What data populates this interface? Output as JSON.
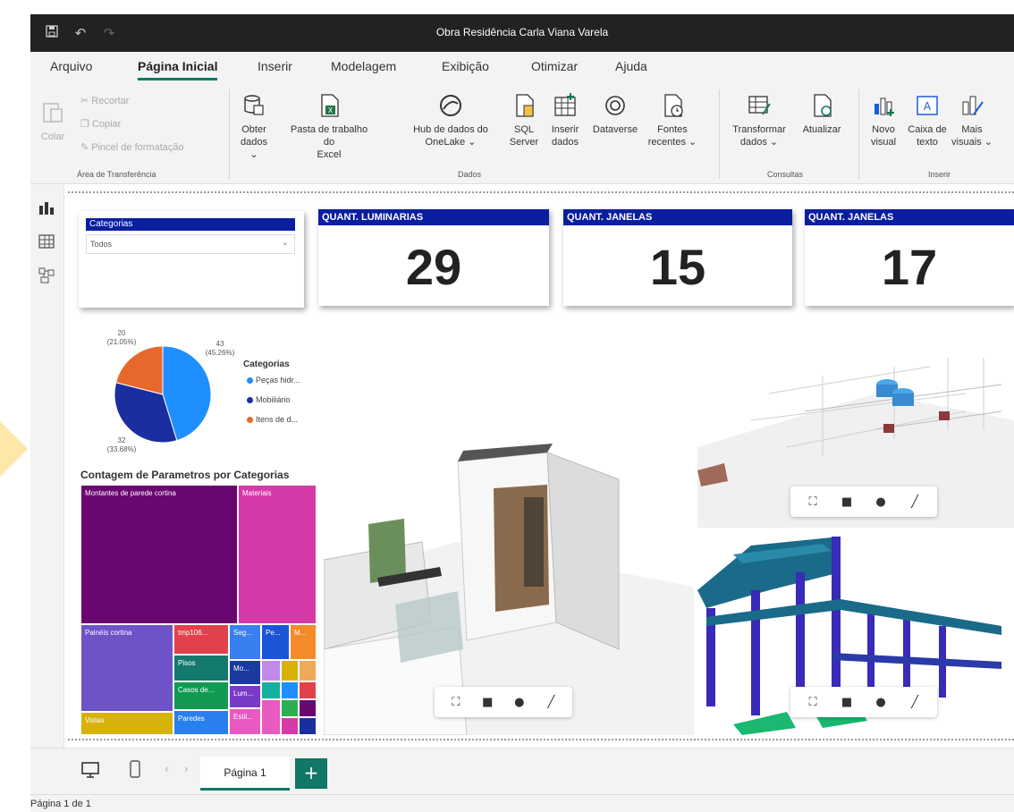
{
  "window": {
    "title": "Obra Residência Carla Viana Varela"
  },
  "menu": {
    "tabs": [
      {
        "label": "Arquivo"
      },
      {
        "label": "Página Inicial"
      },
      {
        "label": "Inserir"
      },
      {
        "label": "Modelagem"
      },
      {
        "label": "Exibição"
      },
      {
        "label": "Otimizar"
      },
      {
        "label": "Ajuda"
      }
    ]
  },
  "ribbon": {
    "clipboard": {
      "paste": "Colar",
      "cut": "Recortar",
      "copy": "Copiar",
      "format_painter": "Pincel de formatação",
      "group": "Área de Transferência"
    },
    "data": {
      "get_data_1": "Obter",
      "get_data_2": "dados ⌄",
      "excel_1": "Pasta de trabalho do",
      "excel_2": "Excel",
      "onelake_1": "Hub de dados do",
      "onelake_2": "OneLake ⌄",
      "sql_1": "SQL",
      "sql_2": "Server",
      "insert_1": "Inserir",
      "insert_2": "dados",
      "dataverse": "Dataverse",
      "recent_1": "Fontes",
      "recent_2": "recentes ⌄",
      "group": "Dados"
    },
    "queries": {
      "transform_1": "Transformar",
      "transform_2": "dados ⌄",
      "refresh": "Atualizar",
      "group": "Consultas"
    },
    "insert": {
      "new_visual_1": "Novo",
      "new_visual_2": "visual",
      "textbox_1": "Caixa de",
      "textbox_2": "texto",
      "more_1": "Mais",
      "more_2": "visuais ⌄",
      "group": "Inserir"
    }
  },
  "slicer": {
    "title": "Categorias",
    "value": "Todos"
  },
  "kpis": [
    {
      "label": "QUANT. LUMINARIAS",
      "value": "29"
    },
    {
      "label": "QUANT. JANELAS",
      "value": "15"
    },
    {
      "label": "QUANT. JANELAS",
      "value": "17"
    }
  ],
  "pie": {
    "legend_title": "Categorias",
    "slices": [
      {
        "name": "Peças hidr...",
        "value": 43,
        "pct": "(45.26%)",
        "color": "#1f8fff"
      },
      {
        "name": "Mobiliário",
        "value": 32,
        "pct": "(33.68%)",
        "color": "#1a2ea0"
      },
      {
        "name": "Itens de d...",
        "value": 20,
        "pct": "(21.05%)",
        "color": "#e8682c"
      }
    ]
  },
  "treemap": {
    "title": "Contagem de Parametros por Categorias",
    "tiles": [
      {
        "label": "Montantes de parede cortina",
        "color": "#6a0670"
      },
      {
        "label": "Materiais",
        "color": "#d63aa8"
      },
      {
        "label": "Painéis cortina",
        "color": "#6d52c8"
      },
      {
        "label": "Vistas",
        "color": "#d6b20a"
      },
      {
        "label": "tmp106...",
        "color": "#e0414a"
      },
      {
        "label": "Pisos",
        "color": "#157a6e"
      },
      {
        "label": "Casos de...",
        "color": "#129a52"
      },
      {
        "label": "Paredes",
        "color": "#2a7ff0"
      },
      {
        "label": "Seg...",
        "color": "#3a7ff0"
      },
      {
        "label": "Pe...",
        "color": "#1a55d8"
      },
      {
        "label": "M...",
        "color": "#f58a2a"
      },
      {
        "label": "Mo...",
        "color": "#1a3aa0"
      },
      {
        "label": "Lum...",
        "color": "#7a3ac8"
      },
      {
        "label": "Estil...",
        "color": "#e85ac0"
      }
    ]
  },
  "pages": {
    "current": "Página 1",
    "status": "Página 1 de 1"
  }
}
